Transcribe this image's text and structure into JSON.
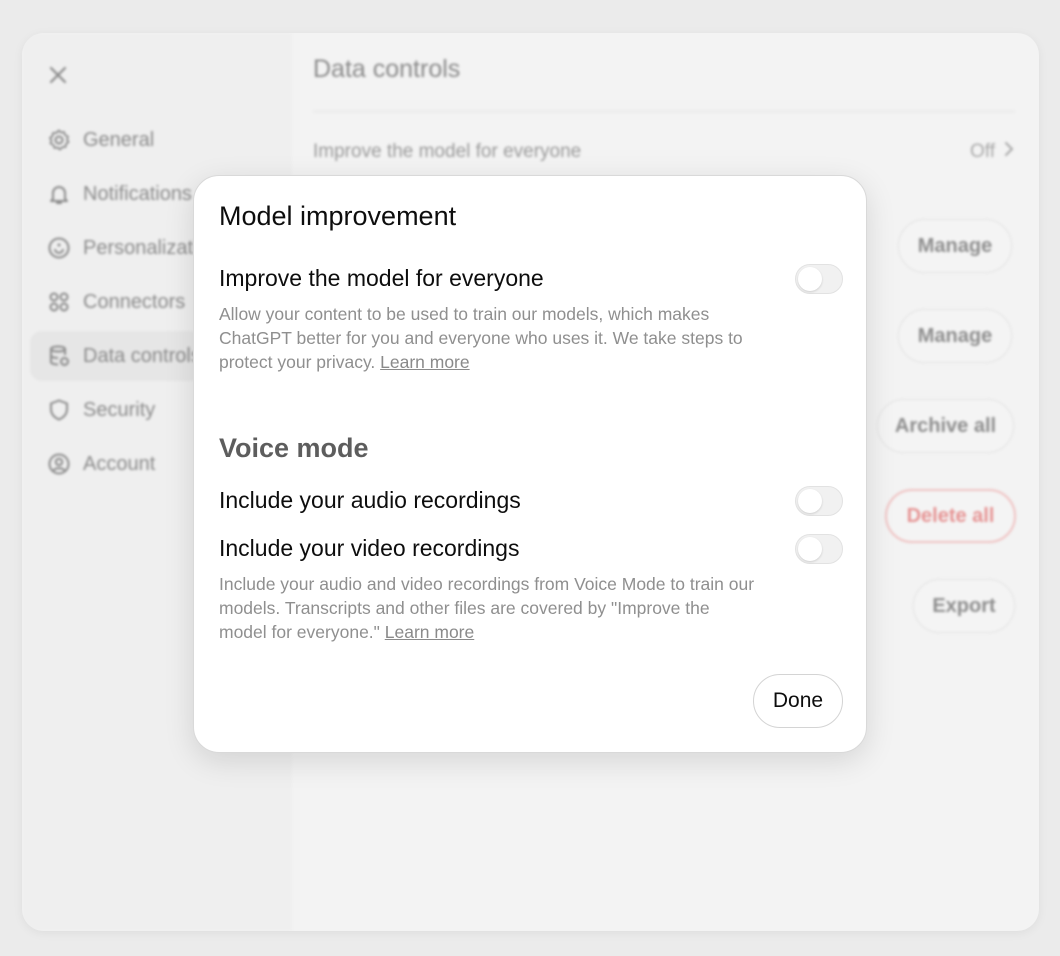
{
  "background": {
    "sidebar": {
      "items": [
        {
          "label": "General",
          "icon": "gear-icon"
        },
        {
          "label": "Notifications",
          "icon": "bell-icon"
        },
        {
          "label": "Personalization",
          "icon": "personalization-icon"
        },
        {
          "label": "Connectors",
          "icon": "connectors-icon"
        },
        {
          "label": "Data controls",
          "icon": "database-icon",
          "active": true
        },
        {
          "label": "Security",
          "icon": "shield-icon"
        },
        {
          "label": "Account",
          "icon": "account-icon"
        }
      ]
    },
    "main": {
      "title": "Data controls",
      "improve_row": {
        "label": "Improve the model for everyone",
        "value": "Off"
      },
      "buttons": {
        "manage_1": "Manage",
        "manage_2": "Manage",
        "archive_all": "Archive all",
        "delete_all": "Delete all",
        "export": "Export"
      }
    }
  },
  "modal": {
    "title": "Model improvement",
    "improve": {
      "label": "Improve the model for everyone",
      "description": "Allow your content to be used to train our models, which makes ChatGPT better for you and everyone who uses it. We take steps to protect your privacy. ",
      "link": "Learn more",
      "enabled": false
    },
    "voice": {
      "title": "Voice mode",
      "audio_label": "Include your audio recordings",
      "audio_enabled": false,
      "video_label": "Include your video recordings",
      "video_enabled": false,
      "description": "Include your audio and video recordings from Voice Mode to train our models. Transcripts and other files are covered by \"Improve the model for everyone.\" ",
      "link": "Learn more"
    },
    "done_label": "Done"
  },
  "colors": {
    "danger": "#e69494",
    "toggle_off": "#f1f1f1"
  }
}
